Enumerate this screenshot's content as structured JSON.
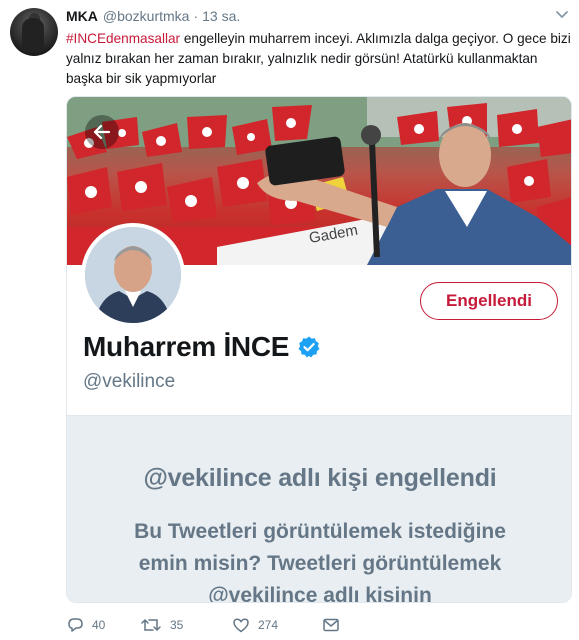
{
  "tweet": {
    "display_name": "MKA",
    "handle": "@bozkurtmka",
    "separator": "·",
    "time": "13 sa.",
    "hashtag": "#INCEdenmasallar",
    "text": " engelleyin muharrem inceyi. Aklımızla dalga geçiyor. O gece bizi yalnız bırakan her zaman bırakır, yalnızlık nedir görsün! Atatürkü kullanmaktan başka bir sik yapmıyorlar",
    "colors": {
      "hashtag": "#c71b3a",
      "secondary_text": "#657786"
    }
  },
  "card": {
    "profile_name": "Muharrem İNCE",
    "profile_handle": "@vekilince",
    "block_button": "Engellendi",
    "blocked_title": "@vekilince adlı kişi engellendi",
    "blocked_body": "Bu Tweetleri görüntülemek istediğine emin misin? Tweetleri görüntülemek @vekilince adlı kişinin",
    "banner_sign": "Gadem",
    "icons": {
      "back": "back-arrow-icon",
      "verified": "verified-badge-icon"
    }
  },
  "actions": {
    "reply_count": "40",
    "retweet_count": "35",
    "like_count": "274",
    "icons": [
      "reply-icon",
      "retweet-icon",
      "like-icon",
      "message-icon"
    ]
  }
}
